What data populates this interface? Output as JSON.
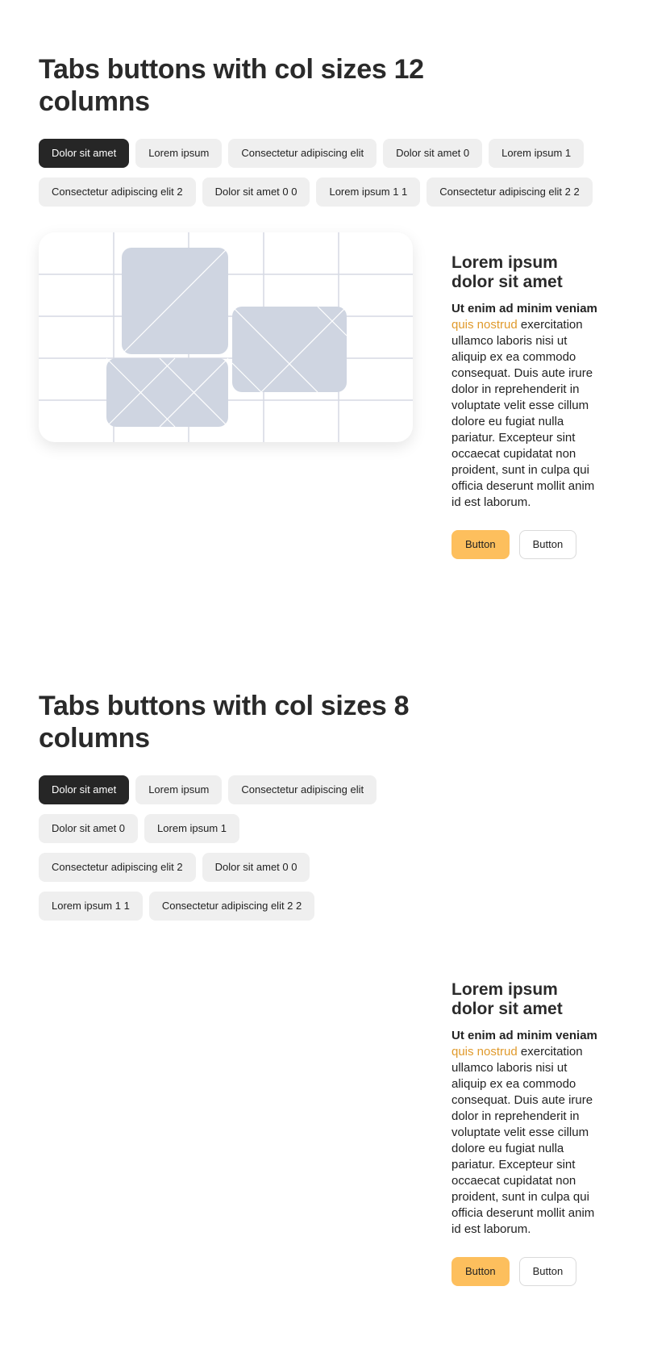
{
  "sections": [
    {
      "title": "Tabs buttons with col sizes 12 columns",
      "tabs": [
        "Dolor sit amet",
        "Lorem ipsum",
        "Consectetur adipiscing elit",
        "Dolor sit amet 0",
        "Lorem ipsum 1",
        "Consectetur adipiscing elit 2",
        "Dolor sit amet 0 0",
        "Lorem ipsum 1 1",
        "Consectetur adipiscing elit 2 2"
      ],
      "active_tab": 0,
      "has_image": true,
      "heading": "Lorem ipsum dolor sit amet",
      "body_bold": "Ut enim ad minim veniam",
      "body_link": "quis nostrud",
      "body_rest": "exercitation ullamco laboris nisi ut aliquip ex ea commodo consequat. Duis aute irure dolor in reprehenderit in voluptate velit esse cillum dolore eu fugiat nulla pariatur. Excepteur sint occaecat cupidatat non proident, sunt in culpa qui officia deserunt mollit anim id est laborum.",
      "primary_button": "Button",
      "secondary_button": "Button"
    },
    {
      "title": "Tabs buttons with col sizes 8 columns",
      "tabs": [
        "Dolor sit amet",
        "Lorem ipsum",
        "Consectetur adipiscing elit",
        "Dolor sit amet 0",
        "Lorem ipsum 1",
        "Consectetur adipiscing elit 2",
        "Dolor sit amet 0 0",
        "Lorem ipsum 1 1",
        "Consectetur adipiscing elit 2 2"
      ],
      "active_tab": 0,
      "has_image": false,
      "heading": "Lorem ipsum dolor sit amet",
      "body_bold": "Ut enim ad minim veniam",
      "body_link": "quis nostrud",
      "body_rest": "exercitation ullamco laboris nisi ut aliquip ex ea commodo consequat. Duis aute irure dolor in reprehenderit in voluptate velit esse cillum dolore eu fugiat nulla pariatur. Excepteur sint occaecat cupidatat non proident, sunt in culpa qui officia deserunt mollit anim id est laborum.",
      "primary_button": "Button",
      "secondary_button": "Button"
    }
  ],
  "colors": {
    "active_tab_bg": "#262626",
    "tab_bg": "#efefef",
    "accent_link": "#e09a2c",
    "primary_button_bg": "#fdbf5d",
    "placeholder_fill": "#cfd5e1"
  }
}
